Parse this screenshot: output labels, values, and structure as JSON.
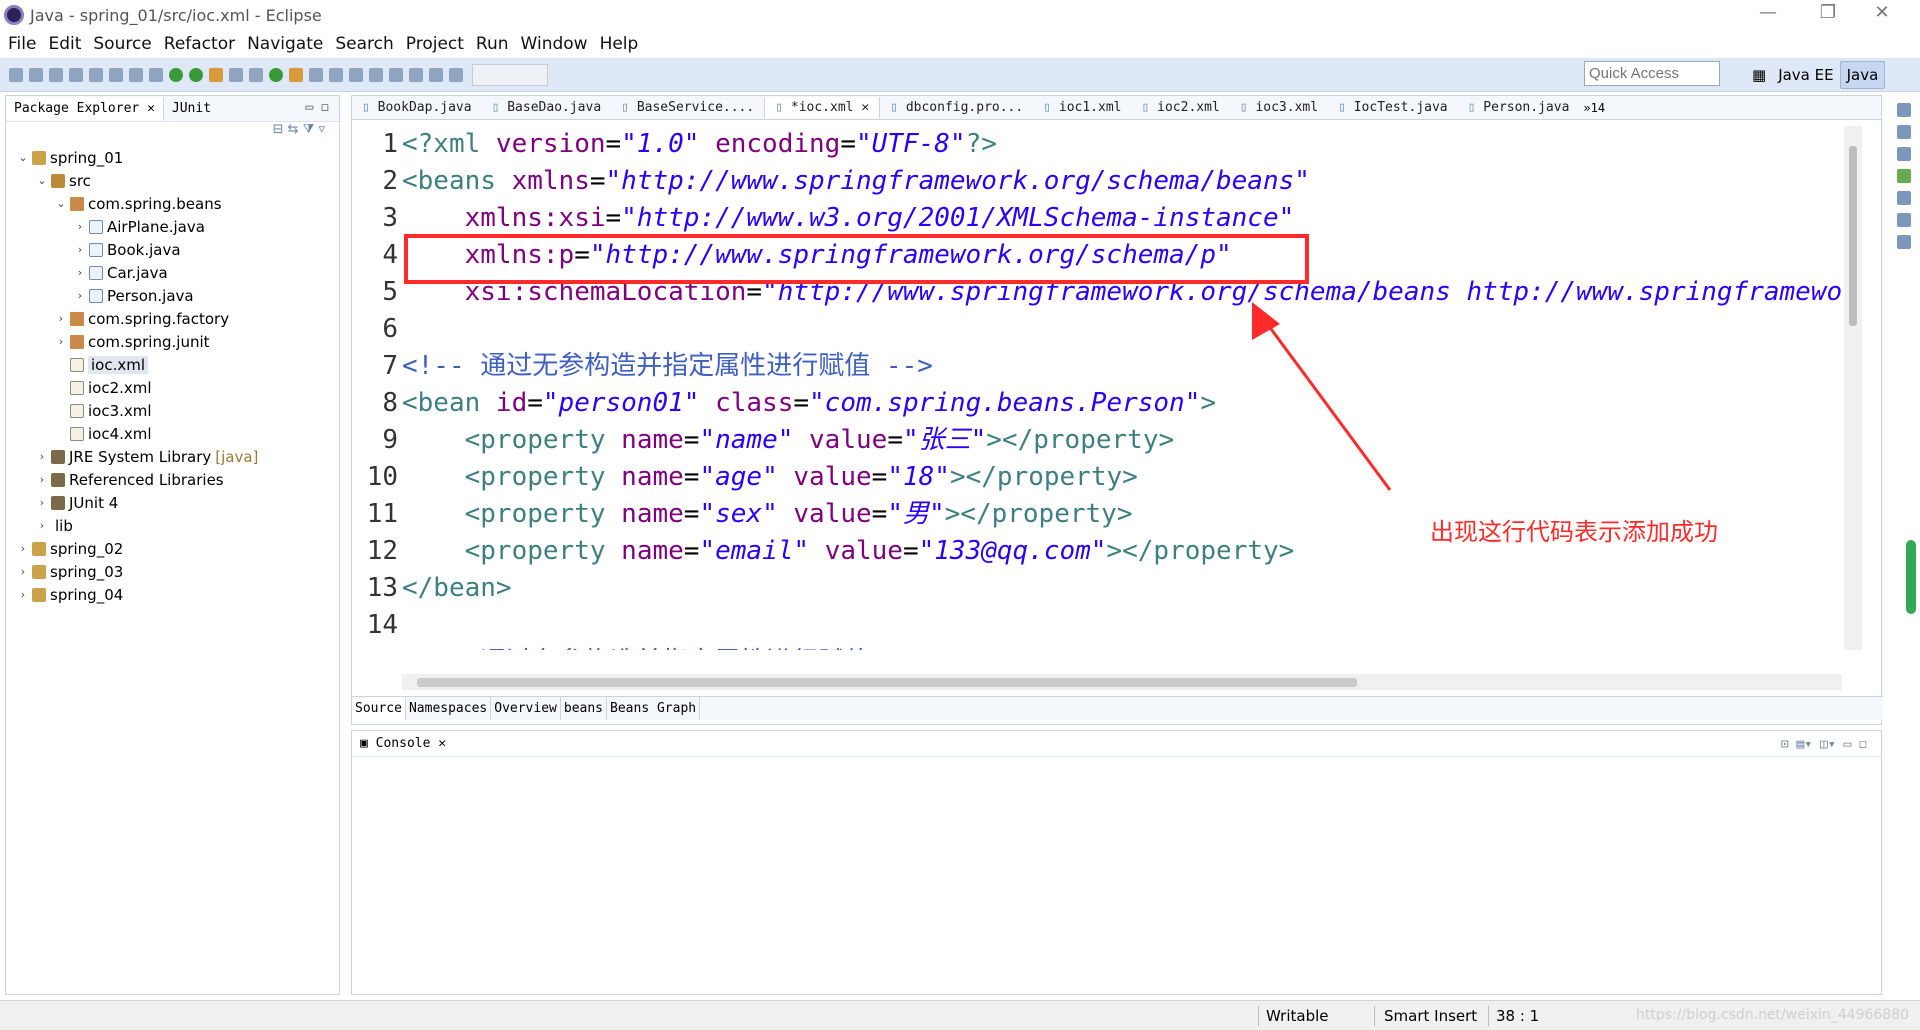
{
  "window": {
    "title": "Java - spring_01/src/ioc.xml - Eclipse",
    "minimize": "—",
    "restore": "❐",
    "close": "✕"
  },
  "menu": [
    "File",
    "Edit",
    "Source",
    "Refactor",
    "Navigate",
    "Search",
    "Project",
    "Run",
    "Window",
    "Help"
  ],
  "toolbar": {
    "quick_access_placeholder": "Quick Access",
    "perspectives": [
      "Java EE",
      "Java"
    ]
  },
  "package_explorer": {
    "tabs": [
      "Package Explorer",
      "JUnit"
    ],
    "tree": [
      {
        "label": "spring_01",
        "icon": "project-icon",
        "level": 0,
        "twisty": "⌄"
      },
      {
        "label": "src",
        "icon": "source-folder-icon",
        "level": 1,
        "twisty": "⌄"
      },
      {
        "label": "com.spring.beans",
        "icon": "package-icon",
        "level": 2,
        "twisty": "⌄"
      },
      {
        "label": "AirPlane.java",
        "icon": "java-file-icon",
        "level": 3,
        "twisty": "›"
      },
      {
        "label": "Book.java",
        "icon": "java-file-icon",
        "level": 3,
        "twisty": "›"
      },
      {
        "label": "Car.java",
        "icon": "java-file-icon",
        "level": 3,
        "twisty": "›"
      },
      {
        "label": "Person.java",
        "icon": "java-file-icon",
        "level": 3,
        "twisty": "›"
      },
      {
        "label": "com.spring.factory",
        "icon": "package-icon",
        "level": 2,
        "twisty": "›"
      },
      {
        "label": "com.spring.junit",
        "icon": "package-icon",
        "level": 2,
        "twisty": "›"
      },
      {
        "label": "ioc.xml",
        "icon": "xml-file-icon",
        "level": 2,
        "twisty": "",
        "selected": true
      },
      {
        "label": "ioc2.xml",
        "icon": "xml-file-icon",
        "level": 2,
        "twisty": ""
      },
      {
        "label": "ioc3.xml",
        "icon": "xml-file-icon",
        "level": 2,
        "twisty": ""
      },
      {
        "label": "ioc4.xml",
        "icon": "xml-file-icon",
        "level": 2,
        "twisty": ""
      },
      {
        "label": "JRE System Library",
        "suffix": "[java]",
        "icon": "library-icon",
        "level": 1,
        "twisty": "›"
      },
      {
        "label": "Referenced Libraries",
        "icon": "library-icon",
        "level": 1,
        "twisty": "›"
      },
      {
        "label": "JUnit 4",
        "icon": "library-icon",
        "level": 1,
        "twisty": "›"
      },
      {
        "label": "lib",
        "icon": "folder-icon",
        "level": 1,
        "twisty": "›"
      },
      {
        "label": "spring_02",
        "icon": "project-icon",
        "level": 0,
        "twisty": "›"
      },
      {
        "label": "spring_03",
        "icon": "project-icon",
        "level": 0,
        "twisty": "›"
      },
      {
        "label": "spring_04",
        "icon": "project-icon",
        "level": 0,
        "twisty": "›"
      }
    ]
  },
  "editor": {
    "tabs": [
      {
        "label": "BookDap.java",
        "active": false
      },
      {
        "label": "BaseDao.java",
        "active": false
      },
      {
        "label": "BaseService....",
        "active": false
      },
      {
        "label": "*ioc.xml",
        "active": true
      },
      {
        "label": "dbconfig.pro...",
        "active": false
      },
      {
        "label": "ioc1.xml",
        "active": false
      },
      {
        "label": "ioc2.xml",
        "active": false
      },
      {
        "label": "ioc3.xml",
        "active": false
      },
      {
        "label": "IocTest.java",
        "active": false
      },
      {
        "label": "Person.java",
        "active": false
      }
    ],
    "overflow": "»14",
    "lines": [
      {
        "n": "1",
        "parts": [
          [
            "tg",
            "<?xml "
          ],
          [
            "at",
            "version"
          ],
          [
            "tx",
            "="
          ],
          [
            "av",
            "\"1.0\""
          ],
          [
            "tx",
            " "
          ],
          [
            "at",
            "encoding"
          ],
          [
            "tx",
            "="
          ],
          [
            "av",
            "\"UTF-8\""
          ],
          [
            "tg",
            "?>"
          ]
        ]
      },
      {
        "n": "2",
        "parts": [
          [
            "tg",
            "<beans "
          ],
          [
            "at",
            "xmlns"
          ],
          [
            "tx",
            "="
          ],
          [
            "av",
            "\"http://www.springframework.org/schema/beans\""
          ]
        ]
      },
      {
        "n": "3",
        "parts": [
          [
            "tx",
            "    "
          ],
          [
            "at",
            "xmlns:xsi"
          ],
          [
            "tx",
            "="
          ],
          [
            "av",
            "\"http://www.w3.org/2001/XMLSchema-instance\""
          ]
        ]
      },
      {
        "n": "4",
        "parts": [
          [
            "tx",
            "    "
          ],
          [
            "at",
            "xmlns:p"
          ],
          [
            "tx",
            "="
          ],
          [
            "av",
            "\"http://www.springframework.org/schema/p\""
          ]
        ]
      },
      {
        "n": "5",
        "parts": [
          [
            "tx",
            "    "
          ],
          [
            "at",
            "xsi:schemaLocation"
          ],
          [
            "tx",
            "="
          ],
          [
            "av",
            "\"http://www.springframework.org/schema/beans http://www.springframework.org/schema/beans/spring-beans.xsd\">"
          ]
        ]
      },
      {
        "n": "6",
        "parts": []
      },
      {
        "n": "7",
        "parts": [
          [
            "cm",
            "<!-- 通过无参构造并指定属性进行赋值 -->"
          ]
        ]
      },
      {
        "n": "8",
        "parts": [
          [
            "tg",
            "<bean "
          ],
          [
            "at",
            "id"
          ],
          [
            "tx",
            "="
          ],
          [
            "av",
            "\"person01\""
          ],
          [
            "tx",
            " "
          ],
          [
            "at",
            "class"
          ],
          [
            "tx",
            "="
          ],
          [
            "av",
            "\"com.spring.beans.Person\""
          ],
          [
            "tg",
            ">"
          ]
        ]
      },
      {
        "n": "9",
        "parts": [
          [
            "tx",
            "    "
          ],
          [
            "tg",
            "<property "
          ],
          [
            "at",
            "name"
          ],
          [
            "tx",
            "="
          ],
          [
            "av",
            "\"name\""
          ],
          [
            "tx",
            " "
          ],
          [
            "at",
            "value"
          ],
          [
            "tx",
            "="
          ],
          [
            "av",
            "\"张三\""
          ],
          [
            "tg",
            "></property>"
          ]
        ]
      },
      {
        "n": "10",
        "parts": [
          [
            "tx",
            "    "
          ],
          [
            "tg",
            "<property "
          ],
          [
            "at",
            "name"
          ],
          [
            "tx",
            "="
          ],
          [
            "av",
            "\"age\""
          ],
          [
            "tx",
            " "
          ],
          [
            "at",
            "value"
          ],
          [
            "tx",
            "="
          ],
          [
            "av",
            "\"18\""
          ],
          [
            "tg",
            "></property>"
          ]
        ]
      },
      {
        "n": "11",
        "parts": [
          [
            "tx",
            "    "
          ],
          [
            "tg",
            "<property "
          ],
          [
            "at",
            "name"
          ],
          [
            "tx",
            "="
          ],
          [
            "av",
            "\"sex\""
          ],
          [
            "tx",
            " "
          ],
          [
            "at",
            "value"
          ],
          [
            "tx",
            "="
          ],
          [
            "av",
            "\"男\""
          ],
          [
            "tg",
            "></property>"
          ]
        ]
      },
      {
        "n": "12",
        "parts": [
          [
            "tx",
            "    "
          ],
          [
            "tg",
            "<property "
          ],
          [
            "at",
            "name"
          ],
          [
            "tx",
            "="
          ],
          [
            "av",
            "\"email\""
          ],
          [
            "tx",
            " "
          ],
          [
            "at",
            "value"
          ],
          [
            "tx",
            "="
          ],
          [
            "av",
            "\"133@qq.com\""
          ],
          [
            "tg",
            "></property>"
          ]
        ]
      },
      {
        "n": "13",
        "parts": [
          [
            "tg",
            "</bean>"
          ]
        ]
      },
      {
        "n": "14",
        "parts": []
      },
      {
        "n": "15",
        "parts": [
          [
            "cm",
            "<!-- 通过有参构造并指定属性进行赋值 -->"
          ]
        ]
      }
    ],
    "bottom_tabs": [
      "Source",
      "Namespaces",
      "Overview",
      "beans",
      "Beans Graph"
    ],
    "annotation": "出现这行代码表示添加成功"
  },
  "console": {
    "tab": "Console"
  },
  "status": {
    "writable": "Writable",
    "insert_mode": "Smart Insert",
    "position": "38 : 1",
    "watermark": "https://blog.csdn.net/weixin_44966880"
  },
  "colors": {
    "annotation_red": "#ff2b2b",
    "xml_tag": "#3f7f7f",
    "xml_attr": "#7f007f",
    "xml_value": "#2a00ff",
    "xml_comment": "#3f5fbf"
  }
}
